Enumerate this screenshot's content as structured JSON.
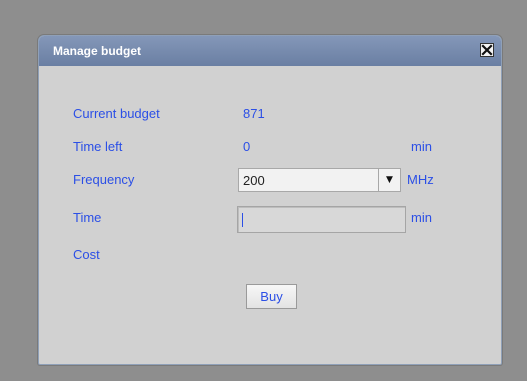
{
  "dialog": {
    "title": "Manage budget",
    "close_icon": "close-icon"
  },
  "fields": {
    "current_budget": {
      "label": "Current budget",
      "value": "871"
    },
    "time_left": {
      "label": "Time left",
      "value": "0",
      "unit": "min"
    },
    "frequency": {
      "label": "Frequency",
      "selected": "200",
      "unit": "MHz",
      "arrow_icon": "chevron-down-icon"
    },
    "time": {
      "label": "Time",
      "value": "",
      "unit": "min"
    },
    "cost": {
      "label": "Cost"
    }
  },
  "actions": {
    "buy_label": "Buy"
  },
  "colors": {
    "text_accent": "#2b4fe6",
    "titlebar": "#7a8db0",
    "dialog_bg": "#d1d1d1",
    "backdrop": "#8e8e8e"
  }
}
